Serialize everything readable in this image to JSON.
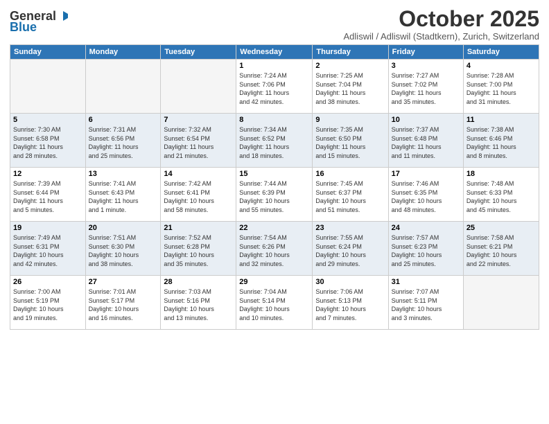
{
  "logo": {
    "general": "General",
    "blue": "Blue"
  },
  "title": "October 2025",
  "subtitle": "Adliswil / Adliswil (Stadtkern), Zurich, Switzerland",
  "weekdays": [
    "Sunday",
    "Monday",
    "Tuesday",
    "Wednesday",
    "Thursday",
    "Friday",
    "Saturday"
  ],
  "weeks": [
    [
      {
        "num": "",
        "info": ""
      },
      {
        "num": "",
        "info": ""
      },
      {
        "num": "",
        "info": ""
      },
      {
        "num": "1",
        "info": "Sunrise: 7:24 AM\nSunset: 7:06 PM\nDaylight: 11 hours\nand 42 minutes."
      },
      {
        "num": "2",
        "info": "Sunrise: 7:25 AM\nSunset: 7:04 PM\nDaylight: 11 hours\nand 38 minutes."
      },
      {
        "num": "3",
        "info": "Sunrise: 7:27 AM\nSunset: 7:02 PM\nDaylight: 11 hours\nand 35 minutes."
      },
      {
        "num": "4",
        "info": "Sunrise: 7:28 AM\nSunset: 7:00 PM\nDaylight: 11 hours\nand 31 minutes."
      }
    ],
    [
      {
        "num": "5",
        "info": "Sunrise: 7:30 AM\nSunset: 6:58 PM\nDaylight: 11 hours\nand 28 minutes."
      },
      {
        "num": "6",
        "info": "Sunrise: 7:31 AM\nSunset: 6:56 PM\nDaylight: 11 hours\nand 25 minutes."
      },
      {
        "num": "7",
        "info": "Sunrise: 7:32 AM\nSunset: 6:54 PM\nDaylight: 11 hours\nand 21 minutes."
      },
      {
        "num": "8",
        "info": "Sunrise: 7:34 AM\nSunset: 6:52 PM\nDaylight: 11 hours\nand 18 minutes."
      },
      {
        "num": "9",
        "info": "Sunrise: 7:35 AM\nSunset: 6:50 PM\nDaylight: 11 hours\nand 15 minutes."
      },
      {
        "num": "10",
        "info": "Sunrise: 7:37 AM\nSunset: 6:48 PM\nDaylight: 11 hours\nand 11 minutes."
      },
      {
        "num": "11",
        "info": "Sunrise: 7:38 AM\nSunset: 6:46 PM\nDaylight: 11 hours\nand 8 minutes."
      }
    ],
    [
      {
        "num": "12",
        "info": "Sunrise: 7:39 AM\nSunset: 6:44 PM\nDaylight: 11 hours\nand 5 minutes."
      },
      {
        "num": "13",
        "info": "Sunrise: 7:41 AM\nSunset: 6:43 PM\nDaylight: 11 hours\nand 1 minute."
      },
      {
        "num": "14",
        "info": "Sunrise: 7:42 AM\nSunset: 6:41 PM\nDaylight: 10 hours\nand 58 minutes."
      },
      {
        "num": "15",
        "info": "Sunrise: 7:44 AM\nSunset: 6:39 PM\nDaylight: 10 hours\nand 55 minutes."
      },
      {
        "num": "16",
        "info": "Sunrise: 7:45 AM\nSunset: 6:37 PM\nDaylight: 10 hours\nand 51 minutes."
      },
      {
        "num": "17",
        "info": "Sunrise: 7:46 AM\nSunset: 6:35 PM\nDaylight: 10 hours\nand 48 minutes."
      },
      {
        "num": "18",
        "info": "Sunrise: 7:48 AM\nSunset: 6:33 PM\nDaylight: 10 hours\nand 45 minutes."
      }
    ],
    [
      {
        "num": "19",
        "info": "Sunrise: 7:49 AM\nSunset: 6:31 PM\nDaylight: 10 hours\nand 42 minutes."
      },
      {
        "num": "20",
        "info": "Sunrise: 7:51 AM\nSunset: 6:30 PM\nDaylight: 10 hours\nand 38 minutes."
      },
      {
        "num": "21",
        "info": "Sunrise: 7:52 AM\nSunset: 6:28 PM\nDaylight: 10 hours\nand 35 minutes."
      },
      {
        "num": "22",
        "info": "Sunrise: 7:54 AM\nSunset: 6:26 PM\nDaylight: 10 hours\nand 32 minutes."
      },
      {
        "num": "23",
        "info": "Sunrise: 7:55 AM\nSunset: 6:24 PM\nDaylight: 10 hours\nand 29 minutes."
      },
      {
        "num": "24",
        "info": "Sunrise: 7:57 AM\nSunset: 6:23 PM\nDaylight: 10 hours\nand 25 minutes."
      },
      {
        "num": "25",
        "info": "Sunrise: 7:58 AM\nSunset: 6:21 PM\nDaylight: 10 hours\nand 22 minutes."
      }
    ],
    [
      {
        "num": "26",
        "info": "Sunrise: 7:00 AM\nSunset: 5:19 PM\nDaylight: 10 hours\nand 19 minutes."
      },
      {
        "num": "27",
        "info": "Sunrise: 7:01 AM\nSunset: 5:17 PM\nDaylight: 10 hours\nand 16 minutes."
      },
      {
        "num": "28",
        "info": "Sunrise: 7:03 AM\nSunset: 5:16 PM\nDaylight: 10 hours\nand 13 minutes."
      },
      {
        "num": "29",
        "info": "Sunrise: 7:04 AM\nSunset: 5:14 PM\nDaylight: 10 hours\nand 10 minutes."
      },
      {
        "num": "30",
        "info": "Sunrise: 7:06 AM\nSunset: 5:13 PM\nDaylight: 10 hours\nand 7 minutes."
      },
      {
        "num": "31",
        "info": "Sunrise: 7:07 AM\nSunset: 5:11 PM\nDaylight: 10 hours\nand 3 minutes."
      },
      {
        "num": "",
        "info": ""
      }
    ]
  ]
}
